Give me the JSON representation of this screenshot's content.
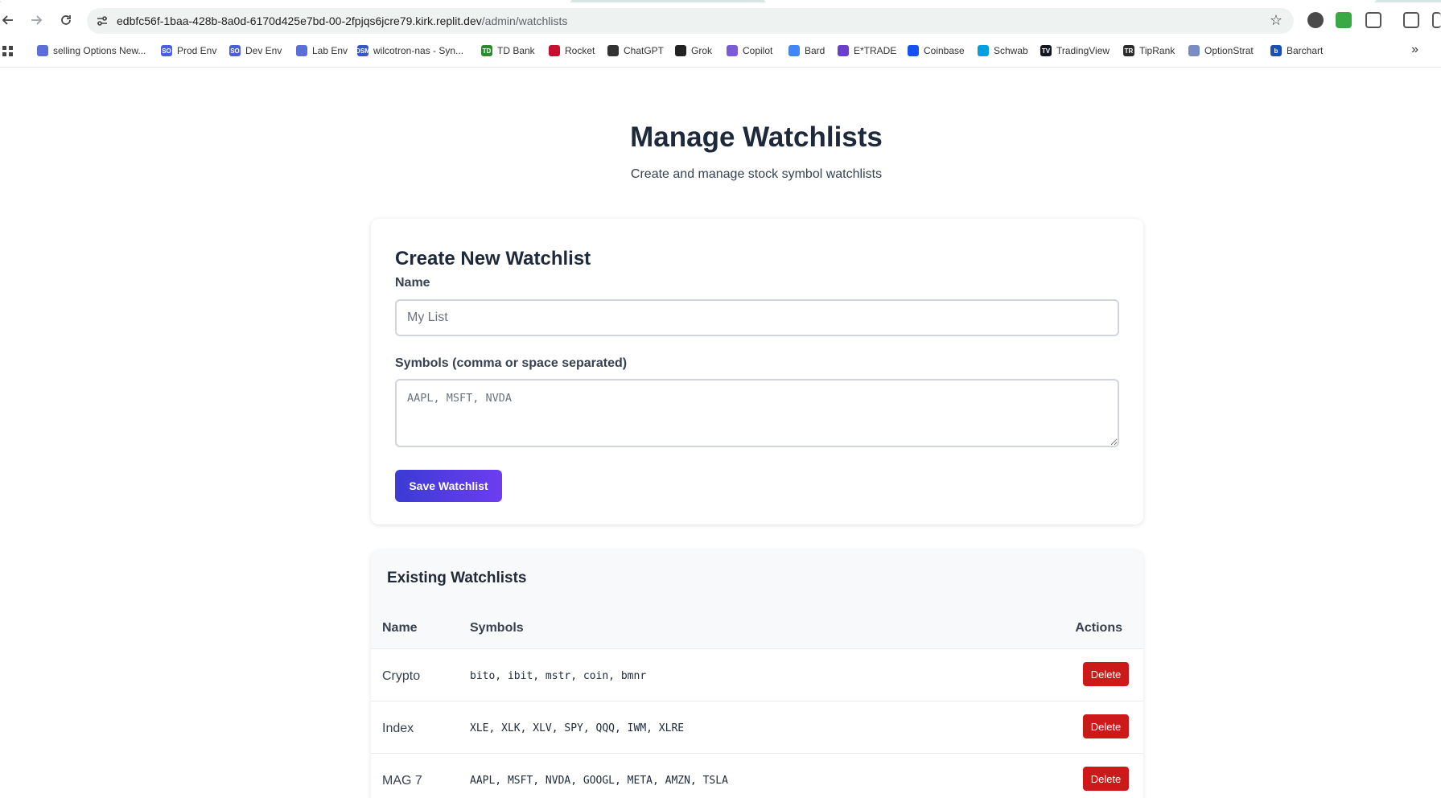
{
  "browser": {
    "url_host": "edbfc56f-1baa-428b-8a0d-6170d425e7bd-00-2fpjqs6jcre79.kirk.replit.dev",
    "url_path": "/admin/watchlists",
    "bookmarks": [
      {
        "label": "selling Options New...",
        "icon_color": "#5b6fd6",
        "icon_text": ""
      },
      {
        "label": "Prod Env",
        "icon_color": "#4a5fe0",
        "icon_text": "SO"
      },
      {
        "label": "Dev Env",
        "icon_color": "#4a5fe0",
        "icon_text": "SO"
      },
      {
        "label": "Lab Env",
        "icon_color": "#5b6fd6",
        "icon_text": ""
      },
      {
        "label": "wilcotron-nas - Syn...",
        "icon_color": "#3557c9",
        "icon_text": "DSM"
      },
      {
        "label": "TD Bank",
        "icon_color": "#2c8a2c",
        "icon_text": "TD"
      },
      {
        "label": "Rocket",
        "icon_color": "#c8102e",
        "icon_text": ""
      },
      {
        "label": "ChatGPT",
        "icon_color": "#333333",
        "icon_text": ""
      },
      {
        "label": "Grok",
        "icon_color": "#222222",
        "icon_text": ""
      },
      {
        "label": "Copilot",
        "icon_color": "#7b5cd6",
        "icon_text": ""
      },
      {
        "label": "Bard",
        "icon_color": "#4285f4",
        "icon_text": ""
      },
      {
        "label": "E*TRADE",
        "icon_color": "#6a3fc9",
        "icon_text": ""
      },
      {
        "label": "Coinbase",
        "icon_color": "#1652f0",
        "icon_text": ""
      },
      {
        "label": "Schwab",
        "icon_color": "#00a0df",
        "icon_text": ""
      },
      {
        "label": "TradingView",
        "icon_color": "#131722",
        "icon_text": "TV"
      },
      {
        "label": "TipRank",
        "icon_color": "#2b2b2b",
        "icon_text": "TR"
      },
      {
        "label": "OptionStrat",
        "icon_color": "#7a8cc4",
        "icon_text": ""
      },
      {
        "label": "Barchart",
        "icon_color": "#1b4fb5",
        "icon_text": "b"
      }
    ]
  },
  "page": {
    "title": "Manage Watchlists",
    "subtitle": "Create and manage stock symbol watchlists"
  },
  "create": {
    "heading": "Create New Watchlist",
    "name_label": "Name",
    "name_placeholder": "My List",
    "symbols_label": "Symbols (comma or space separated)",
    "symbols_placeholder": "AAPL, MSFT, NVDA",
    "save_label": "Save Watchlist"
  },
  "existing": {
    "heading": "Existing Watchlists",
    "columns": {
      "name": "Name",
      "symbols": "Symbols",
      "actions": "Actions"
    },
    "rows": [
      {
        "name": "Crypto",
        "symbols": "bito, ibit, mstr, coin, bmnr",
        "action": "Delete"
      },
      {
        "name": "Index",
        "symbols": "XLE, XLK, XLV, SPY, QQQ, IWM, XLRE",
        "action": "Delete"
      },
      {
        "name": "MAG 7",
        "symbols": "AAPL, MSFT, NVDA, GOOGL, META, AMZN, TSLA",
        "action": "Delete"
      }
    ]
  }
}
